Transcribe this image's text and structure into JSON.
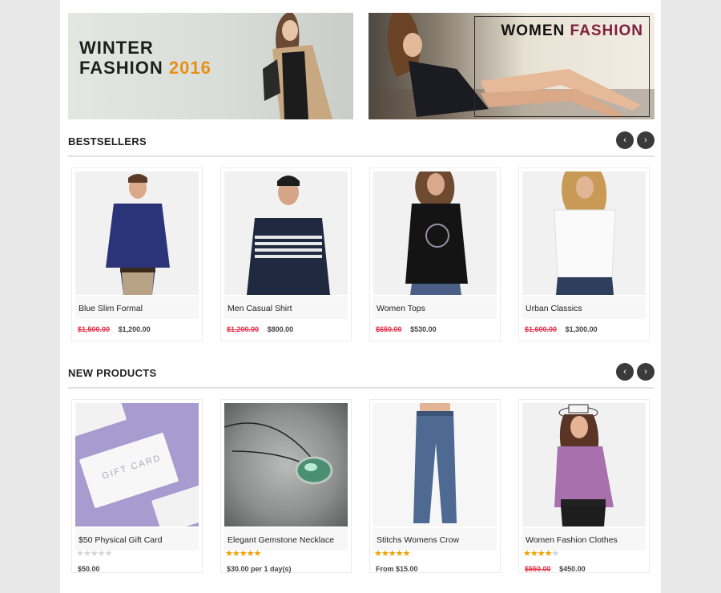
{
  "banners": {
    "left": {
      "line1": "WINTER",
      "line2": "FASHION",
      "year": "2016"
    },
    "right": {
      "word1": "WOMEN",
      "word2": "FASHION"
    }
  },
  "sections": {
    "bestsellers": {
      "title": "BESTSELLERS",
      "prev": "‹",
      "next": "›",
      "products": [
        {
          "name": "Blue Slim Formal",
          "old_price": "$1,500.00",
          "price": "$1,200.00"
        },
        {
          "name": "Men Casual Shirt",
          "old_price": "$1,200.00",
          "price": "$800.00"
        },
        {
          "name": "Women Tops",
          "old_price": "$650.00",
          "price": "$530.00"
        },
        {
          "name": "Urban Classics",
          "old_price": "$1,600.00",
          "price": "$1,300.00"
        }
      ]
    },
    "new_products": {
      "title": "NEW PRODUCTS",
      "prev": "‹",
      "next": "›",
      "products": [
        {
          "name": "$50 Physical Gift Card",
          "rating": 0,
          "old_price": "",
          "price": "$50.00",
          "image_text": "GIFT CARD"
        },
        {
          "name": "Elegant Gemstone Necklace",
          "rating": 5,
          "old_price": "",
          "price": "$30.00 per 1 day(s)"
        },
        {
          "name": "Stitchs Womens Crow",
          "rating": 5,
          "old_price": "",
          "price": "From $15.00"
        },
        {
          "name": "Women Fashion Clothes",
          "rating": 4,
          "old_price": "$550.00",
          "price": "$450.00"
        }
      ]
    }
  },
  "colors": {
    "sale": "#e5324a",
    "star": "#f2a000",
    "accent_orange": "#e69018",
    "accent_wine": "#7d1f3a"
  }
}
